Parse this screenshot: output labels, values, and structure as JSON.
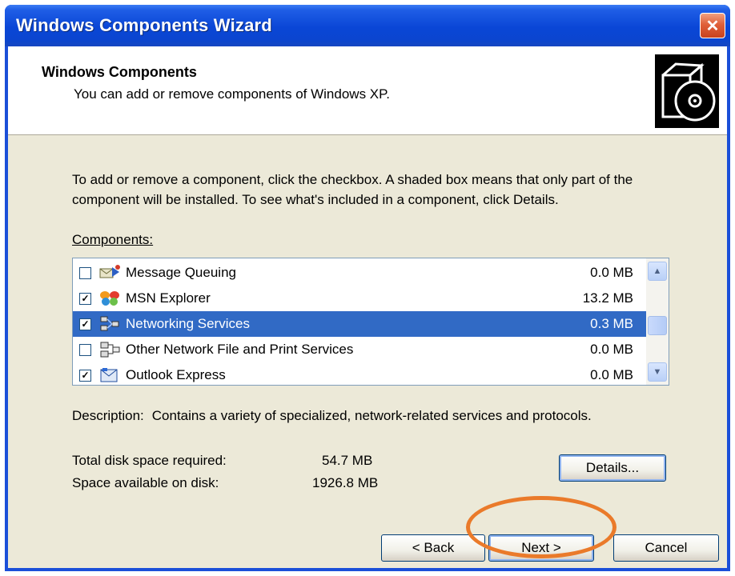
{
  "window": {
    "title": "Windows Components Wizard",
    "close_symbol": "✕"
  },
  "header": {
    "title": "Windows Components",
    "subtitle": "You can add or remove components of Windows XP."
  },
  "body": {
    "intro": "To add or remove a component, click the checkbox.  A shaded box means that only part of the component will be installed.  To see what's included in a component, click Details.",
    "components_label": "Components:"
  },
  "components": [
    {
      "name": "Message Queuing",
      "size": "0.0 MB",
      "checked": false,
      "selected": false,
      "icon": "message-queuing-icon"
    },
    {
      "name": "MSN Explorer",
      "size": "13.2 MB",
      "checked": true,
      "selected": false,
      "icon": "msn-butterfly-icon"
    },
    {
      "name": "Networking Services",
      "size": "0.3 MB",
      "checked": true,
      "selected": true,
      "icon": "network-services-icon"
    },
    {
      "name": "Other Network File and Print Services",
      "size": "0.0 MB",
      "checked": false,
      "selected": false,
      "icon": "network-print-icon"
    },
    {
      "name": "Outlook Express",
      "size": "0.0 MB",
      "checked": true,
      "selected": false,
      "icon": "outlook-express-icon"
    }
  ],
  "description": {
    "label": "Description:",
    "text": "Contains a variety of specialized, network-related services and protocols."
  },
  "disk": {
    "required_label": "Total disk space required:",
    "required_value": "54.7 MB",
    "available_label": "Space available on disk:",
    "available_value": "1926.8 MB"
  },
  "buttons": {
    "details": "Details...",
    "back": "< Back",
    "next": "Next >",
    "cancel": "Cancel"
  },
  "colors": {
    "title_bar": "#0a46d6",
    "selection": "#316ac5",
    "annotation_circle": "#ea7a2a"
  }
}
